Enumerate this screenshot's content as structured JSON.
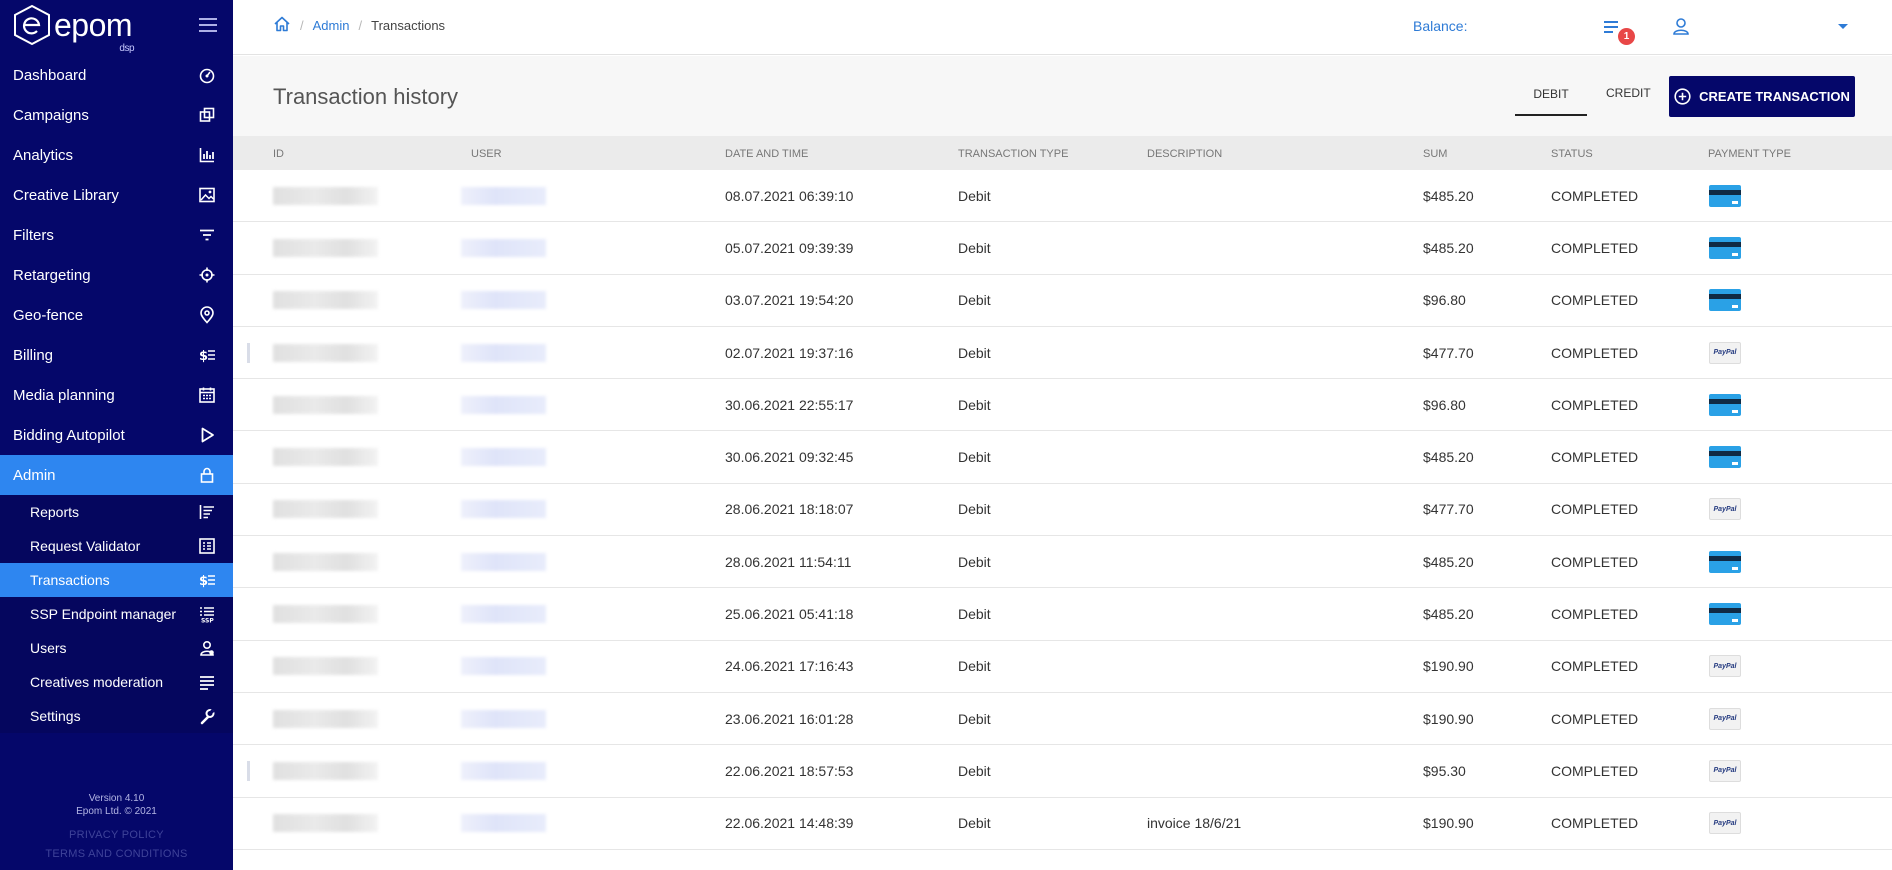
{
  "app": {
    "logo_text": "epom",
    "logo_sub": "dsp"
  },
  "sidebar": {
    "items": [
      {
        "label": "Dashboard",
        "icon": "dashboard-icon"
      },
      {
        "label": "Campaigns",
        "icon": "campaigns-icon"
      },
      {
        "label": "Analytics",
        "icon": "analytics-icon"
      },
      {
        "label": "Creative Library",
        "icon": "image-icon"
      },
      {
        "label": "Filters",
        "icon": "filter-icon"
      },
      {
        "label": "Retargeting",
        "icon": "crosshair-icon"
      },
      {
        "label": "Geo-fence",
        "icon": "location-pin-icon"
      },
      {
        "label": "Billing",
        "icon": "billing-icon"
      },
      {
        "label": "Media planning",
        "icon": "calendar-icon"
      },
      {
        "label": "Bidding Autopilot",
        "icon": "play-icon"
      },
      {
        "label": "Admin",
        "icon": "lock-icon",
        "active": true
      }
    ],
    "subitems": [
      {
        "label": "Reports",
        "icon": "reports-icon"
      },
      {
        "label": "Request Validator",
        "icon": "validator-icon"
      },
      {
        "label": "Transactions",
        "icon": "billing-icon",
        "active": true
      },
      {
        "label": "SSP Endpoint manager",
        "icon": "ssp-icon"
      },
      {
        "label": "Users",
        "icon": "users-icon"
      },
      {
        "label": "Creatives moderation",
        "icon": "moderation-icon"
      },
      {
        "label": "Settings",
        "icon": "wrench-icon"
      }
    ],
    "footer": {
      "version": "Version 4.10",
      "copyright": "Epom Ltd. © 2021",
      "privacy": "PRIVACY POLICY",
      "terms": "TERMS AND CONDITIONS"
    }
  },
  "topbar": {
    "breadcrumb": {
      "home": "home-icon",
      "admin": "Admin",
      "current": "Transactions"
    },
    "balance_label": "Balance:",
    "notification_count": "1"
  },
  "main": {
    "title": "Transaction history",
    "tabs": {
      "debit": "DEBIT",
      "credit": "CREDIT"
    },
    "create_button": "CREATE TRANSACTION"
  },
  "table": {
    "columns": {
      "id": "ID",
      "user": "USER",
      "datetime": "DATE AND TIME",
      "type": "TRANSACTION TYPE",
      "description": "DESCRIPTION",
      "sum": "SUM",
      "status": "STATUS",
      "payment_type": "PAYMENT TYPE"
    },
    "rows": [
      {
        "datetime": "08.07.2021 06:39:10",
        "type": "Debit",
        "description": "",
        "sum": "$485.20",
        "status": "COMPLETED",
        "payment": "card"
      },
      {
        "datetime": "05.07.2021 09:39:39",
        "type": "Debit",
        "description": "",
        "sum": "$485.20",
        "status": "COMPLETED",
        "payment": "card"
      },
      {
        "datetime": "03.07.2021 19:54:20",
        "type": "Debit",
        "description": "",
        "sum": "$96.80",
        "status": "COMPLETED",
        "payment": "card"
      },
      {
        "datetime": "02.07.2021 19:37:16",
        "type": "Debit",
        "description": "",
        "sum": "$477.70",
        "status": "COMPLETED",
        "payment": "paypal"
      },
      {
        "datetime": "30.06.2021 22:55:17",
        "type": "Debit",
        "description": "",
        "sum": "$96.80",
        "status": "COMPLETED",
        "payment": "card"
      },
      {
        "datetime": "30.06.2021 09:32:45",
        "type": "Debit",
        "description": "",
        "sum": "$485.20",
        "status": "COMPLETED",
        "payment": "card"
      },
      {
        "datetime": "28.06.2021 18:18:07",
        "type": "Debit",
        "description": "",
        "sum": "$477.70",
        "status": "COMPLETED",
        "payment": "paypal"
      },
      {
        "datetime": "28.06.2021 11:54:11",
        "type": "Debit",
        "description": "",
        "sum": "$485.20",
        "status": "COMPLETED",
        "payment": "card"
      },
      {
        "datetime": "25.06.2021 05:41:18",
        "type": "Debit",
        "description": "",
        "sum": "$485.20",
        "status": "COMPLETED",
        "payment": "card"
      },
      {
        "datetime": "24.06.2021 17:16:43",
        "type": "Debit",
        "description": "",
        "sum": "$190.90",
        "status": "COMPLETED",
        "payment": "paypal"
      },
      {
        "datetime": "23.06.2021 16:01:28",
        "type": "Debit",
        "description": "",
        "sum": "$190.90",
        "status": "COMPLETED",
        "payment": "paypal"
      },
      {
        "datetime": "22.06.2021 18:57:53",
        "type": "Debit",
        "description": "",
        "sum": "$95.30",
        "status": "COMPLETED",
        "payment": "paypal"
      },
      {
        "datetime": "22.06.2021 14:48:39",
        "type": "Debit",
        "description": "invoice 18/6/21",
        "sum": "$190.90",
        "status": "COMPLETED",
        "payment": "paypal"
      }
    ],
    "payment_labels": {
      "paypal": "PayPal"
    }
  },
  "colors": {
    "sidebar_bg": "#05076a",
    "accent": "#2e86f0",
    "link": "#2e7bd6",
    "badge": "#e84747"
  }
}
